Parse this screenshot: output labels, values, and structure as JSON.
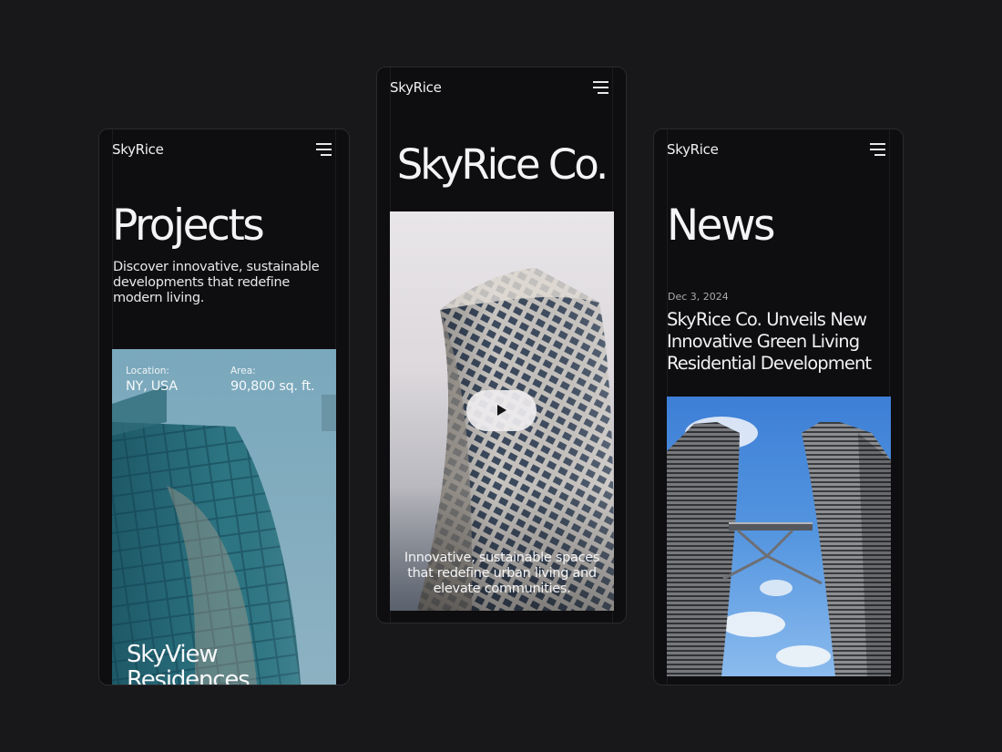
{
  "screens": {
    "projects": {
      "brand": "SkyRice",
      "menu_icon": "hamburger-menu-icon",
      "title": "Projects",
      "description": "Discover innovative, sustainable developments that redefine modern living.",
      "card": {
        "location_label": "Location:",
        "location_value": "NY, USA",
        "area_label": "Area:",
        "area_value": "90,800 sq. ft.",
        "name": "SkyView Residences"
      }
    },
    "home": {
      "brand": "SkyRice",
      "menu_icon": "hamburger-menu-icon",
      "title": "SkyRice Co.",
      "video": {
        "play_icon": "play-icon",
        "caption": "Innovative, sustainable spaces that redefine urban living and elevate communities."
      }
    },
    "news": {
      "brand": "SkyRice",
      "menu_icon": "hamburger-menu-icon",
      "title": "News",
      "article": {
        "date": "Dec 3, 2024",
        "headline": "SkyRice Co. Unveils New Innovative Green Living Residential Development"
      }
    }
  },
  "colors": {
    "background": "#18171a",
    "screen": "#0e0d10",
    "text": "#ecebee",
    "muted": "#a9a8ad"
  }
}
